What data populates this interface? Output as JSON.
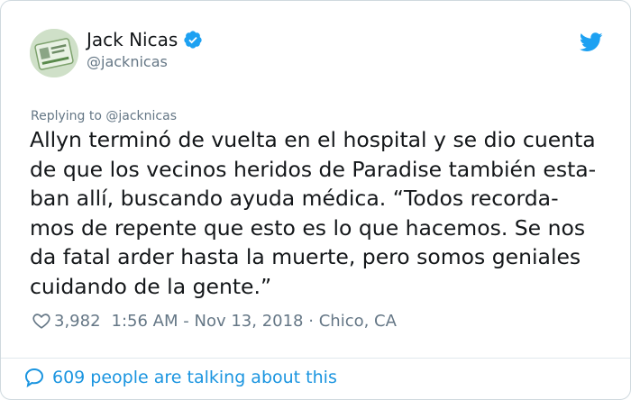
{
  "author": {
    "name": "Jack Nicas",
    "handle": "@jacknicas",
    "verified": true,
    "avatar_icon": "avatar-photo-icon"
  },
  "brand": {
    "icon": "twitter-bird-icon",
    "color": "#1da1f2"
  },
  "tweet": {
    "replying_to": "Replying to @jacknicas",
    "lines": [
      "Allyn terminó de vuelta en el hospital y se dio cuenta",
      "de que los vecinos heridos de Paradise también esta-",
      "ban allí, buscando ayuda médica. “Todos recorda-",
      "mos de repente que esto es lo que hacemos. Se nos",
      "da fatal arder hasta la muerte, pero somos geniales",
      "cuidando de la gente.”"
    ]
  },
  "meta": {
    "likes": "3,982",
    "time": "1:56 AM",
    "sep1": "-",
    "date": "Nov 13, 2018",
    "sep2": "·",
    "location": "Chico, CA"
  },
  "footer": {
    "talking_text": "609 people are talking about this",
    "link_color": "#1b95e0"
  }
}
